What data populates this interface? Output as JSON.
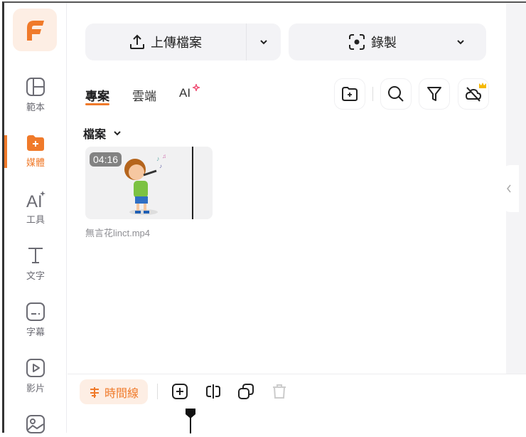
{
  "sidebar": {
    "items": [
      {
        "label": "範本",
        "icon": "template-icon"
      },
      {
        "label": "媒體",
        "icon": "media-folder-icon",
        "active": true
      },
      {
        "label": "工具",
        "icon": "ai-tools-icon"
      },
      {
        "label": "文字",
        "icon": "text-icon"
      },
      {
        "label": "字幕",
        "icon": "subtitle-icon"
      },
      {
        "label": "影片",
        "icon": "video-icon"
      }
    ]
  },
  "toolbar": {
    "upload_label": "上傳檔案",
    "record_label": "錄製"
  },
  "tabs": [
    {
      "label": "專案",
      "active": true
    },
    {
      "label": "雲端"
    },
    {
      "label": "AI"
    }
  ],
  "section": {
    "label": "檔案"
  },
  "media": [
    {
      "duration": "04:16",
      "filename": "無言花linct.mp4"
    }
  ],
  "timeline": {
    "label": "時間線"
  },
  "colors": {
    "accent": "#f07a2a",
    "accent_bg": "#fdeee4"
  }
}
